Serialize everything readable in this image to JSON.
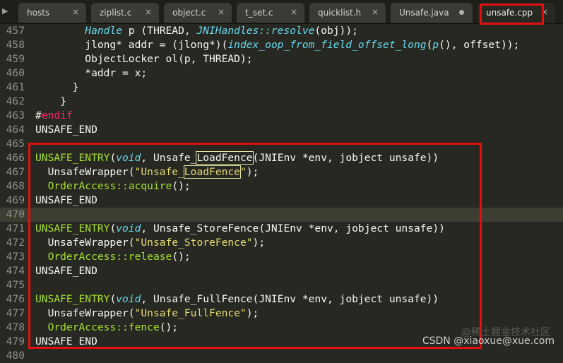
{
  "tabs": [
    {
      "label": "hosts",
      "marker": "×"
    },
    {
      "label": "ziplist.c",
      "marker": "×"
    },
    {
      "label": "object.c",
      "marker": "×"
    },
    {
      "label": "t_set.c",
      "marker": "×"
    },
    {
      "label": "quicklist.h",
      "marker": "×"
    },
    {
      "label": "Unsafe.java",
      "marker": "dot"
    },
    {
      "label": "unsafe.cpp",
      "marker": "×"
    }
  ],
  "tab_scroll_icon": "▶",
  "active_tab": "unsafe.cpp",
  "highlight_color": "#e01010",
  "current_line": "470",
  "lines": [
    {
      "num": "457",
      "segs": [
        {
          "t": "        "
        },
        {
          "t": "Handle",
          "c": "type"
        },
        {
          "t": " p (THREAD, "
        },
        {
          "t": "JNIHandles::resolve",
          "c": "type"
        },
        {
          "t": "(obj));"
        }
      ]
    },
    {
      "num": "458",
      "segs": [
        {
          "t": "        jlong* addr = (jlong*)("
        },
        {
          "t": "index_oop_from_field_offset_long",
          "c": "type"
        },
        {
          "t": "("
        },
        {
          "t": "p",
          "c": "type"
        },
        {
          "t": "(), offset));"
        }
      ]
    },
    {
      "num": "459",
      "segs": [
        {
          "t": "        ObjectLocker ol(p, THREAD);"
        }
      ]
    },
    {
      "num": "460",
      "segs": [
        {
          "t": "        *addr = x;"
        }
      ]
    },
    {
      "num": "461",
      "segs": [
        {
          "t": "      }"
        }
      ]
    },
    {
      "num": "462",
      "segs": [
        {
          "t": "    }"
        }
      ]
    },
    {
      "num": "463",
      "segs": [
        {
          "t": "#"
        },
        {
          "t": "endif",
          "c": "kw"
        }
      ]
    },
    {
      "num": "464",
      "segs": [
        {
          "t": "UNSAFE_END"
        }
      ]
    },
    {
      "num": "465",
      "segs": [
        {
          "t": ""
        }
      ]
    },
    {
      "num": "466",
      "segs": [
        {
          "t": "UNSAFE_ENTRY",
          "c": "mac"
        },
        {
          "t": "("
        },
        {
          "t": "void",
          "c": "type"
        },
        {
          "t": ", Unsafe_"
        },
        {
          "t": "LoadFence",
          "h": true
        },
        {
          "t": "(JNIEnv *env, jobject unsafe))"
        }
      ]
    },
    {
      "num": "467",
      "segs": [
        {
          "t": "  UnsafeWrapper("
        },
        {
          "t": "\"Unsafe_",
          "c": "str"
        },
        {
          "t": "LoadFence",
          "c": "str",
          "h": true
        },
        {
          "t": "\"",
          "c": "str"
        },
        {
          "t": ");"
        }
      ]
    },
    {
      "num": "468",
      "segs": [
        {
          "t": "  "
        },
        {
          "t": "OrderAccess::",
          "c": "mac"
        },
        {
          "t": "acquire",
          "c": "mac"
        },
        {
          "t": "();"
        }
      ]
    },
    {
      "num": "469",
      "segs": [
        {
          "t": "UNSAFE_END"
        }
      ]
    },
    {
      "num": "470",
      "segs": [
        {
          "t": ""
        }
      ]
    },
    {
      "num": "471",
      "segs": [
        {
          "t": "UNSAFE_ENTRY",
          "c": "mac"
        },
        {
          "t": "("
        },
        {
          "t": "void",
          "c": "type"
        },
        {
          "t": ", Unsafe_StoreFence(JNIEnv *env, jobject unsafe))"
        }
      ]
    },
    {
      "num": "472",
      "segs": [
        {
          "t": "  UnsafeWrapper("
        },
        {
          "t": "\"Unsafe_StoreFence\"",
          "c": "str"
        },
        {
          "t": ");"
        }
      ]
    },
    {
      "num": "473",
      "segs": [
        {
          "t": "  "
        },
        {
          "t": "OrderAccess::release",
          "c": "mac"
        },
        {
          "t": "();"
        }
      ]
    },
    {
      "num": "474",
      "segs": [
        {
          "t": "UNSAFE_END"
        }
      ]
    },
    {
      "num": "475",
      "segs": [
        {
          "t": ""
        }
      ]
    },
    {
      "num": "476",
      "segs": [
        {
          "t": "UNSAFE_ENTRY",
          "c": "mac"
        },
        {
          "t": "("
        },
        {
          "t": "void",
          "c": "type"
        },
        {
          "t": ", Unsafe_FullFence(JNIEnv *env, jobject unsafe))"
        }
      ]
    },
    {
      "num": "477",
      "segs": [
        {
          "t": "  UnsafeWrapper("
        },
        {
          "t": "\"Unsafe_FullFence\"",
          "c": "str"
        },
        {
          "t": ");"
        }
      ]
    },
    {
      "num": "478",
      "segs": [
        {
          "t": "  "
        },
        {
          "t": "OrderAccess::fence",
          "c": "mac"
        },
        {
          "t": "();"
        }
      ]
    },
    {
      "num": "479",
      "segs": [
        {
          "t": "UNSAFE_END"
        }
      ]
    },
    {
      "num": "480",
      "segs": [
        {
          "t": ""
        }
      ]
    }
  ],
  "watermark": "CSDN @xiaoxue@xue.com",
  "watermark2": "@稀土掘金技术社区"
}
